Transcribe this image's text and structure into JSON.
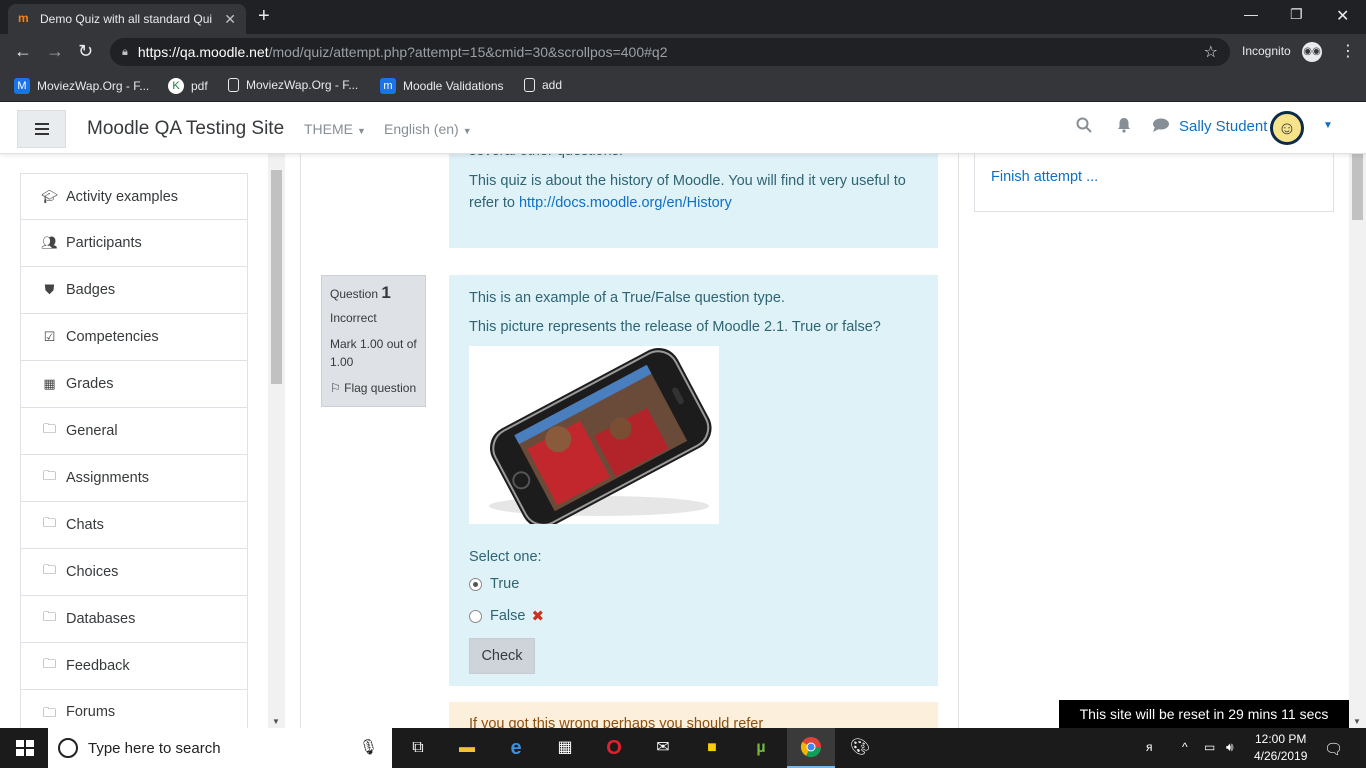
{
  "browser": {
    "tab_title": "Demo Quiz with all standard Qui",
    "tab_favicon": "moodle-m",
    "url_host": "https://qa.moodle.net",
    "url_rest": "/mod/quiz/attempt.php?attempt=15&cmid=30&scrollpos=400#q2",
    "incognito_label": "Incognito",
    "bookmarks": [
      {
        "label": "MoviezWap.Org - F...",
        "icon": "moviezwap-icon"
      },
      {
        "label": "pdf",
        "icon": "pdf-icon"
      },
      {
        "label": "MoviezWap.Org - F...",
        "icon": "page-icon"
      },
      {
        "label": "Moodle Validations",
        "icon": "moodle-icon"
      },
      {
        "label": "add",
        "icon": "page-icon"
      }
    ]
  },
  "navbar": {
    "site_name": "Moodle QA Testing Site",
    "theme_label": "THEME",
    "language_label": "English (en)",
    "user_name": "Sally Student"
  },
  "sidebar": {
    "items": [
      {
        "label": "Activity examples",
        "icon": "graduation-cap-icon"
      },
      {
        "label": "Participants",
        "icon": "users-icon"
      },
      {
        "label": "Badges",
        "icon": "shield-icon"
      },
      {
        "label": "Competencies",
        "icon": "check-square-icon"
      },
      {
        "label": "Grades",
        "icon": "table-icon"
      },
      {
        "label": "General",
        "icon": "folder-icon"
      },
      {
        "label": "Assignments",
        "icon": "folder-icon"
      },
      {
        "label": "Chats",
        "icon": "folder-icon"
      },
      {
        "label": "Choices",
        "icon": "folder-icon"
      },
      {
        "label": "Databases",
        "icon": "folder-icon"
      },
      {
        "label": "Feedback",
        "icon": "folder-icon"
      },
      {
        "label": "Forums",
        "icon": "folder-icon"
      }
    ]
  },
  "intro": {
    "cut_text": "several other questions.",
    "text": "This quiz is about the history of Moodle. You will find it very useful to refer to",
    "link": "http://docs.moodle.org/en/History"
  },
  "question": {
    "label": "Question",
    "number": "1",
    "state": "Incorrect",
    "mark": "Mark 1.00 out of 1.00",
    "flag_label": "Flag question",
    "text1": "This is an example of a True/False question type.",
    "text2": "This picture represents the release of  Moodle 2.1. True or false?",
    "select_prompt": "Select one:",
    "options": [
      {
        "label": "True",
        "selected": true
      },
      {
        "label": "False",
        "selected": false
      }
    ],
    "check_label": "Check",
    "feedback_text": "If you got this wrong perhaps you should refer"
  },
  "quiz_nav": {
    "finish_label": "Finish attempt ..."
  },
  "reset_notice": "This site will be reset in 29 mins 11 secs",
  "taskbar": {
    "search_placeholder": "Type here to search",
    "time": "12:00 PM",
    "date": "4/26/2019"
  },
  "colors": {
    "moodle_link": "#0f6fc5",
    "info_bg": "#def2f8",
    "warning_bg": "#fcefdc",
    "wrong": "#ca3120"
  }
}
